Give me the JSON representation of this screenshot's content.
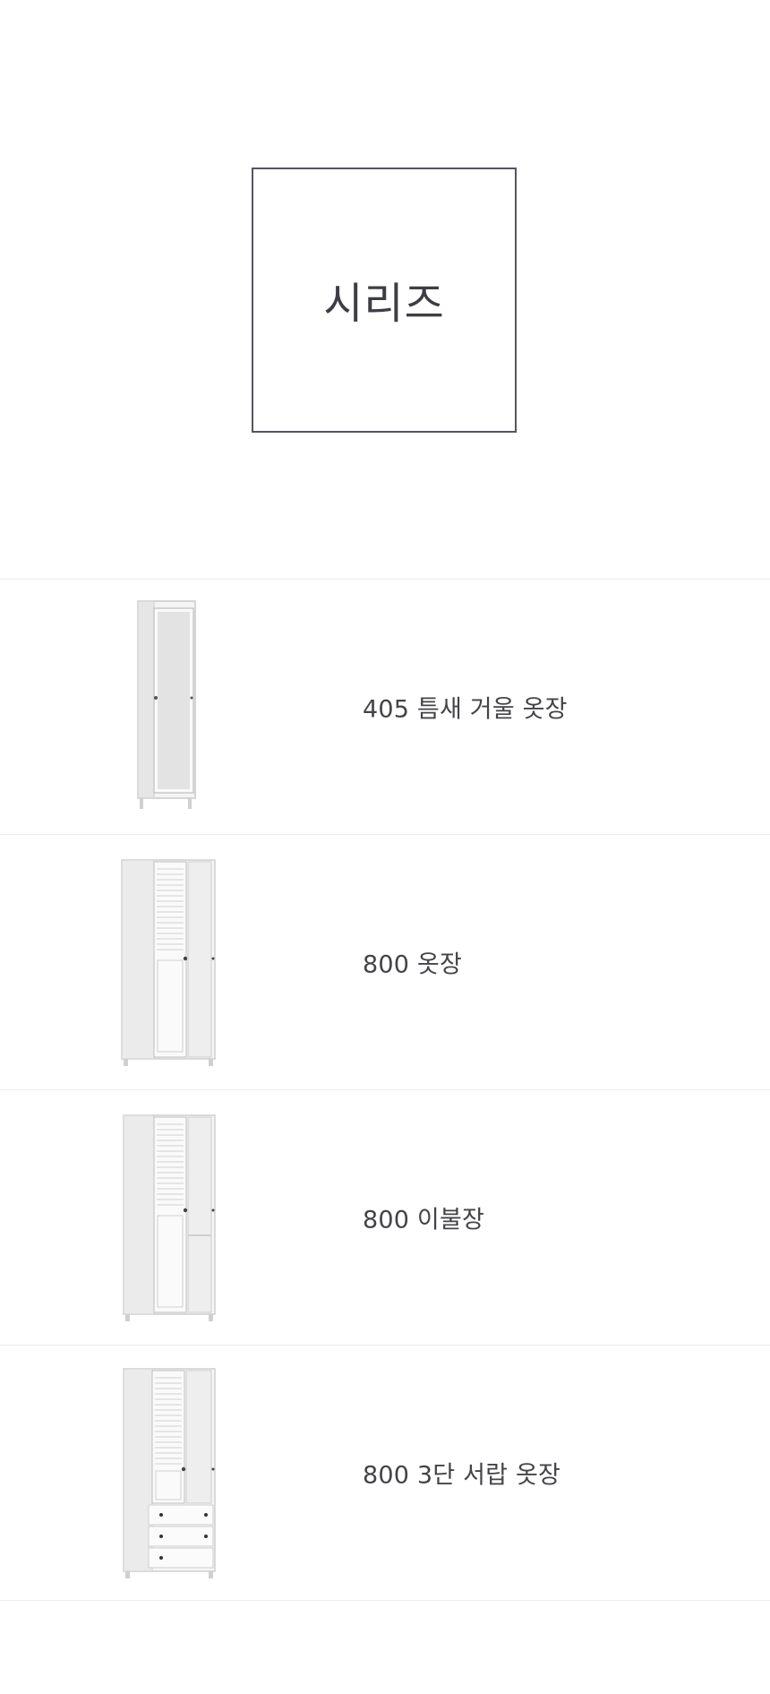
{
  "hero": {
    "title": "시리즈"
  },
  "products": [
    {
      "name": "405 틈새 거울 옷장",
      "image": "mirror-wardrobe-icon"
    },
    {
      "name": "800 옷장",
      "image": "wardrobe-icon"
    },
    {
      "name": "800 이불장",
      "image": "blanket-cabinet-icon"
    },
    {
      "name": "800 3단 서랍 옷장",
      "image": "drawer-wardrobe-icon"
    }
  ]
}
